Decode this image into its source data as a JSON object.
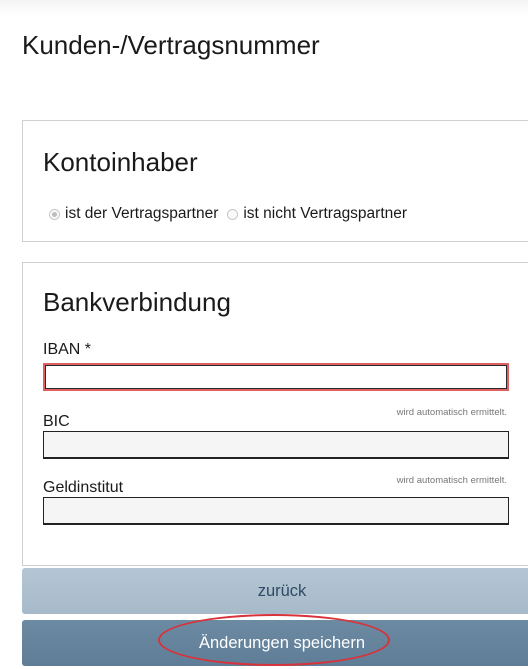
{
  "page": {
    "title": "Kunden-/Vertragsnummer"
  },
  "kontoinhaber": {
    "title": "Kontoinhaber",
    "options": [
      {
        "label": "ist der Vertragspartner",
        "selected": true
      },
      {
        "label": "ist nicht Vertragspartner",
        "selected": false
      }
    ]
  },
  "bankverbindung": {
    "title": "Bankverbindung",
    "iban": {
      "label": "IBAN *",
      "value": ""
    },
    "bic": {
      "label": "BIC",
      "hint": "wird automatisch ermittelt.",
      "value": ""
    },
    "geldinstitut": {
      "label": "Geldinstitut",
      "hint": "wird automatisch ermittelt.",
      "value": ""
    }
  },
  "buttons": {
    "back": "zurück",
    "save": "Änderungen speichern"
  },
  "colors": {
    "back_button": "#aabccb",
    "save_button": "#6682a0",
    "error_border": "#e06060",
    "highlight": "#d8323a"
  }
}
